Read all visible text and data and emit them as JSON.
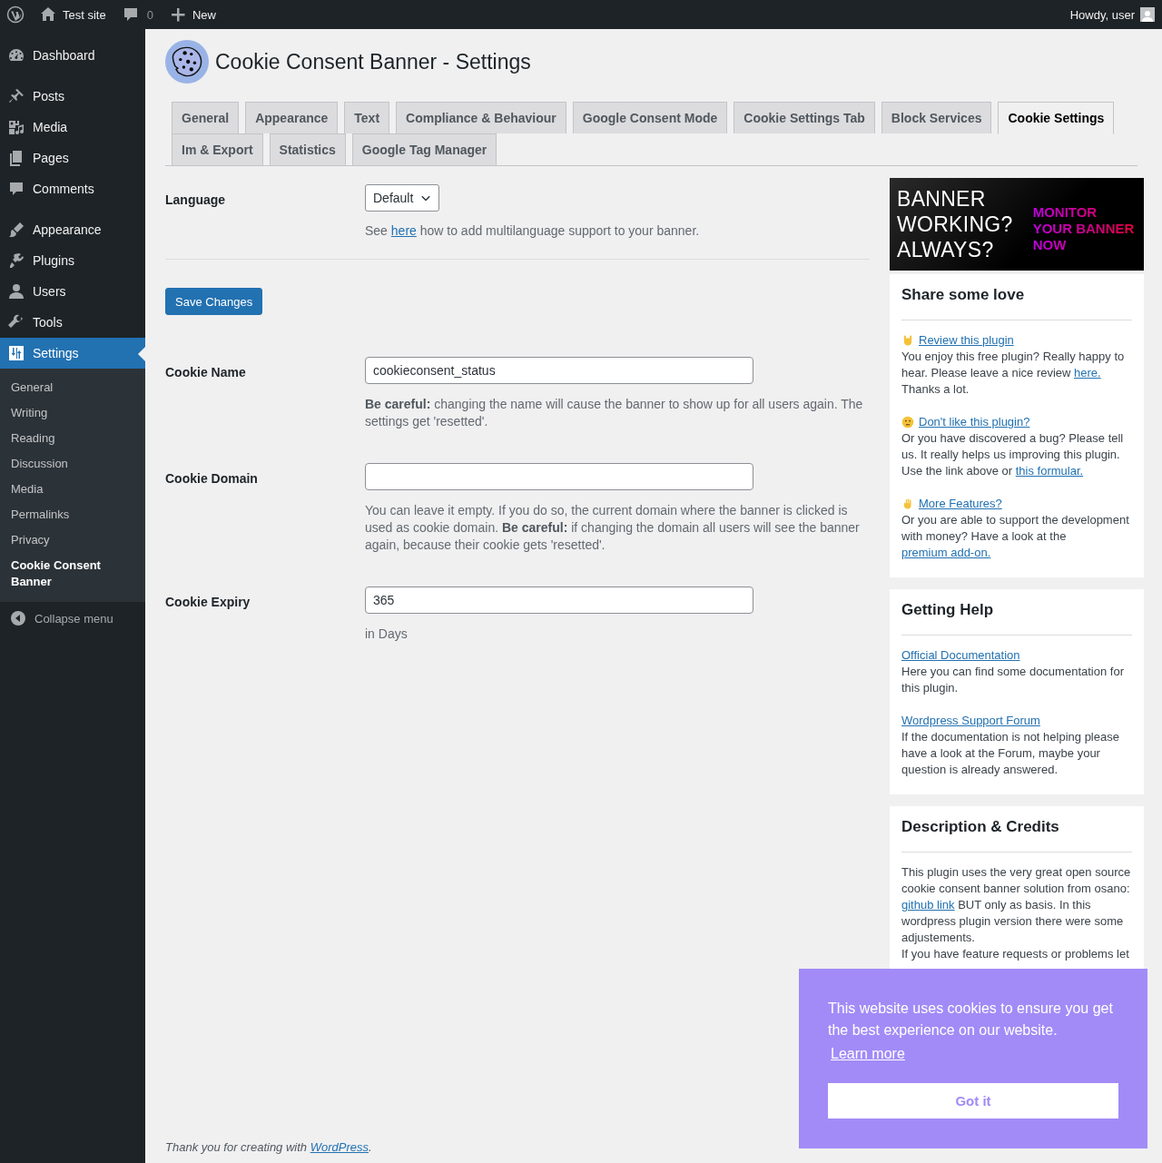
{
  "admin_bar": {
    "site": "Test site",
    "comments": "0",
    "new": "New",
    "greeting": "Howdy, user"
  },
  "menu": [
    {
      "kind": "dashboard",
      "label": "Dashboard",
      "selected": false
    },
    {
      "kind": "posts",
      "label": "Posts",
      "selected": false
    },
    {
      "kind": "media",
      "label": "Media",
      "selected": false
    },
    {
      "kind": "pages",
      "label": "Pages",
      "selected": false
    },
    {
      "kind": "comments",
      "label": "Comments",
      "selected": false
    },
    {
      "kind": "appearance",
      "label": "Appearance",
      "selected": false
    },
    {
      "kind": "plugins",
      "label": "Plugins",
      "selected": false
    },
    {
      "kind": "users",
      "label": "Users",
      "selected": false
    },
    {
      "kind": "tools",
      "label": "Tools",
      "selected": false
    },
    {
      "kind": "settings",
      "label": "Settings",
      "selected": true,
      "children": [
        {
          "label": "General",
          "selected": false
        },
        {
          "label": "Writing",
          "selected": false
        },
        {
          "label": "Reading",
          "selected": false
        },
        {
          "label": "Discussion",
          "selected": false
        },
        {
          "label": "Media",
          "selected": false
        },
        {
          "label": "Permalinks",
          "selected": false
        },
        {
          "label": "Privacy",
          "selected": false
        },
        {
          "label": "Cookie Consent Banner",
          "selected": true
        }
      ]
    }
  ],
  "collapse": "Collapse menu",
  "page_title": "Cookie Consent Banner - Settings",
  "tabs": [
    {
      "label": "General",
      "selected": false
    },
    {
      "label": "Appearance",
      "selected": false
    },
    {
      "label": "Text",
      "selected": false
    },
    {
      "label": "Compliance & Behaviour",
      "selected": false
    },
    {
      "label": "Google Consent Mode",
      "selected": false
    },
    {
      "label": "Cookie Settings Tab",
      "selected": false
    },
    {
      "label": "Block Services",
      "selected": false
    },
    {
      "label": "Cookie Settings",
      "selected": true
    },
    {
      "label": "Im & Export",
      "selected": false
    },
    {
      "label": "Statistics",
      "selected": false
    },
    {
      "label": "Google Tag Manager",
      "selected": false
    }
  ],
  "language": {
    "label": "Language",
    "value": "Default",
    "help": [
      {
        "text": "See ",
        "link": false
      },
      {
        "text": "here",
        "link": true
      },
      {
        "text": " how to add multilanguage support to your banner.",
        "link": false
      }
    ]
  },
  "save_button": "Save Changes",
  "fields": [
    {
      "label": "Cookie Name",
      "value": "cookieconsent_status",
      "help": "**Be careful:** changing the name will cause the banner to show up for all users again. The settings get 'resetted'."
    },
    {
      "label": "Cookie Domain",
      "help": "You can leave it empty. If you do so, the current domain where the banner is clicked is used as cookie domain. **Be careful:** if changing the domain all users will see the banner again, because their cookie gets 'resetted'."
    },
    {
      "label": "Cookie Expiry",
      "value": "365",
      "help": "in Days"
    }
  ],
  "ad": {
    "question": [
      "BANNER",
      "WORKING?",
      "ALWAYS?"
    ],
    "call": [
      "MONITOR",
      "YOUR BANNER",
      "NOW"
    ]
  },
  "cards": [
    {
      "title": "Share some love",
      "blocks": [
        {
          "kind": "rock",
          "link": "Review this plugin",
          "parts": [
            {
              "text": "You enjoy this free plugin? Really happy to hear. Please leave a nice review ",
              "link": false
            },
            {
              "text": "here.",
              "link": true
            },
            {
              "text": " Thanks a lot.",
              "link": false
            }
          ]
        },
        {
          "kind": "face",
          "link": "Don't like this plugin?",
          "parts": [
            {
              "text": "Or you have discovered a bug? Please tell us. It really helps us improving this plugin. Use the link above or ",
              "link": false
            },
            {
              "text": "this formular.",
              "link": true
            }
          ]
        },
        {
          "kind": "hand",
          "link": "More Features?",
          "parts": [
            {
              "text": "Or you are able to support the development with money? Have a look at the ",
              "link": false
            },
            {
              "text": "premium add-on.",
              "link": true
            }
          ]
        }
      ]
    },
    {
      "title": "Getting Help",
      "blocks": [
        {
          "link": "Official Documentation",
          "parts": [
            {
              "text": "Here you can find some documentation for this plugin.",
              "link": false
            }
          ]
        },
        {
          "link": "Wordpress Support Forum",
          "parts": [
            {
              "text": "If the documentation is not helping please have a look at the Forum, maybe your question is already answered.",
              "link": false
            }
          ]
        }
      ]
    },
    {
      "title": "Description & Credits",
      "blocks": [
        {
          "parts": [
            {
              "text": "This plugin uses the very great open source cookie consent banner solution from osano: ",
              "link": false
            },
            {
              "text": "github link",
              "link": true
            },
            {
              "text": " BUT only as basis. In this wordpress plugin version there were some adjustements.",
              "link": false
            }
          ]
        },
        {
          "parts": [
            {
              "text": "If you have feature requests or problems let",
              "link": false
            }
          ]
        }
      ]
    }
  ],
  "footer": {
    "before": "Thank you for creating with ",
    "link": "WordPress",
    "after": "."
  },
  "cookie_banner": {
    "message": "This website uses cookies to ensure you get the best experience on our website.",
    "learn_more": "Learn more",
    "button": "Got it"
  }
}
